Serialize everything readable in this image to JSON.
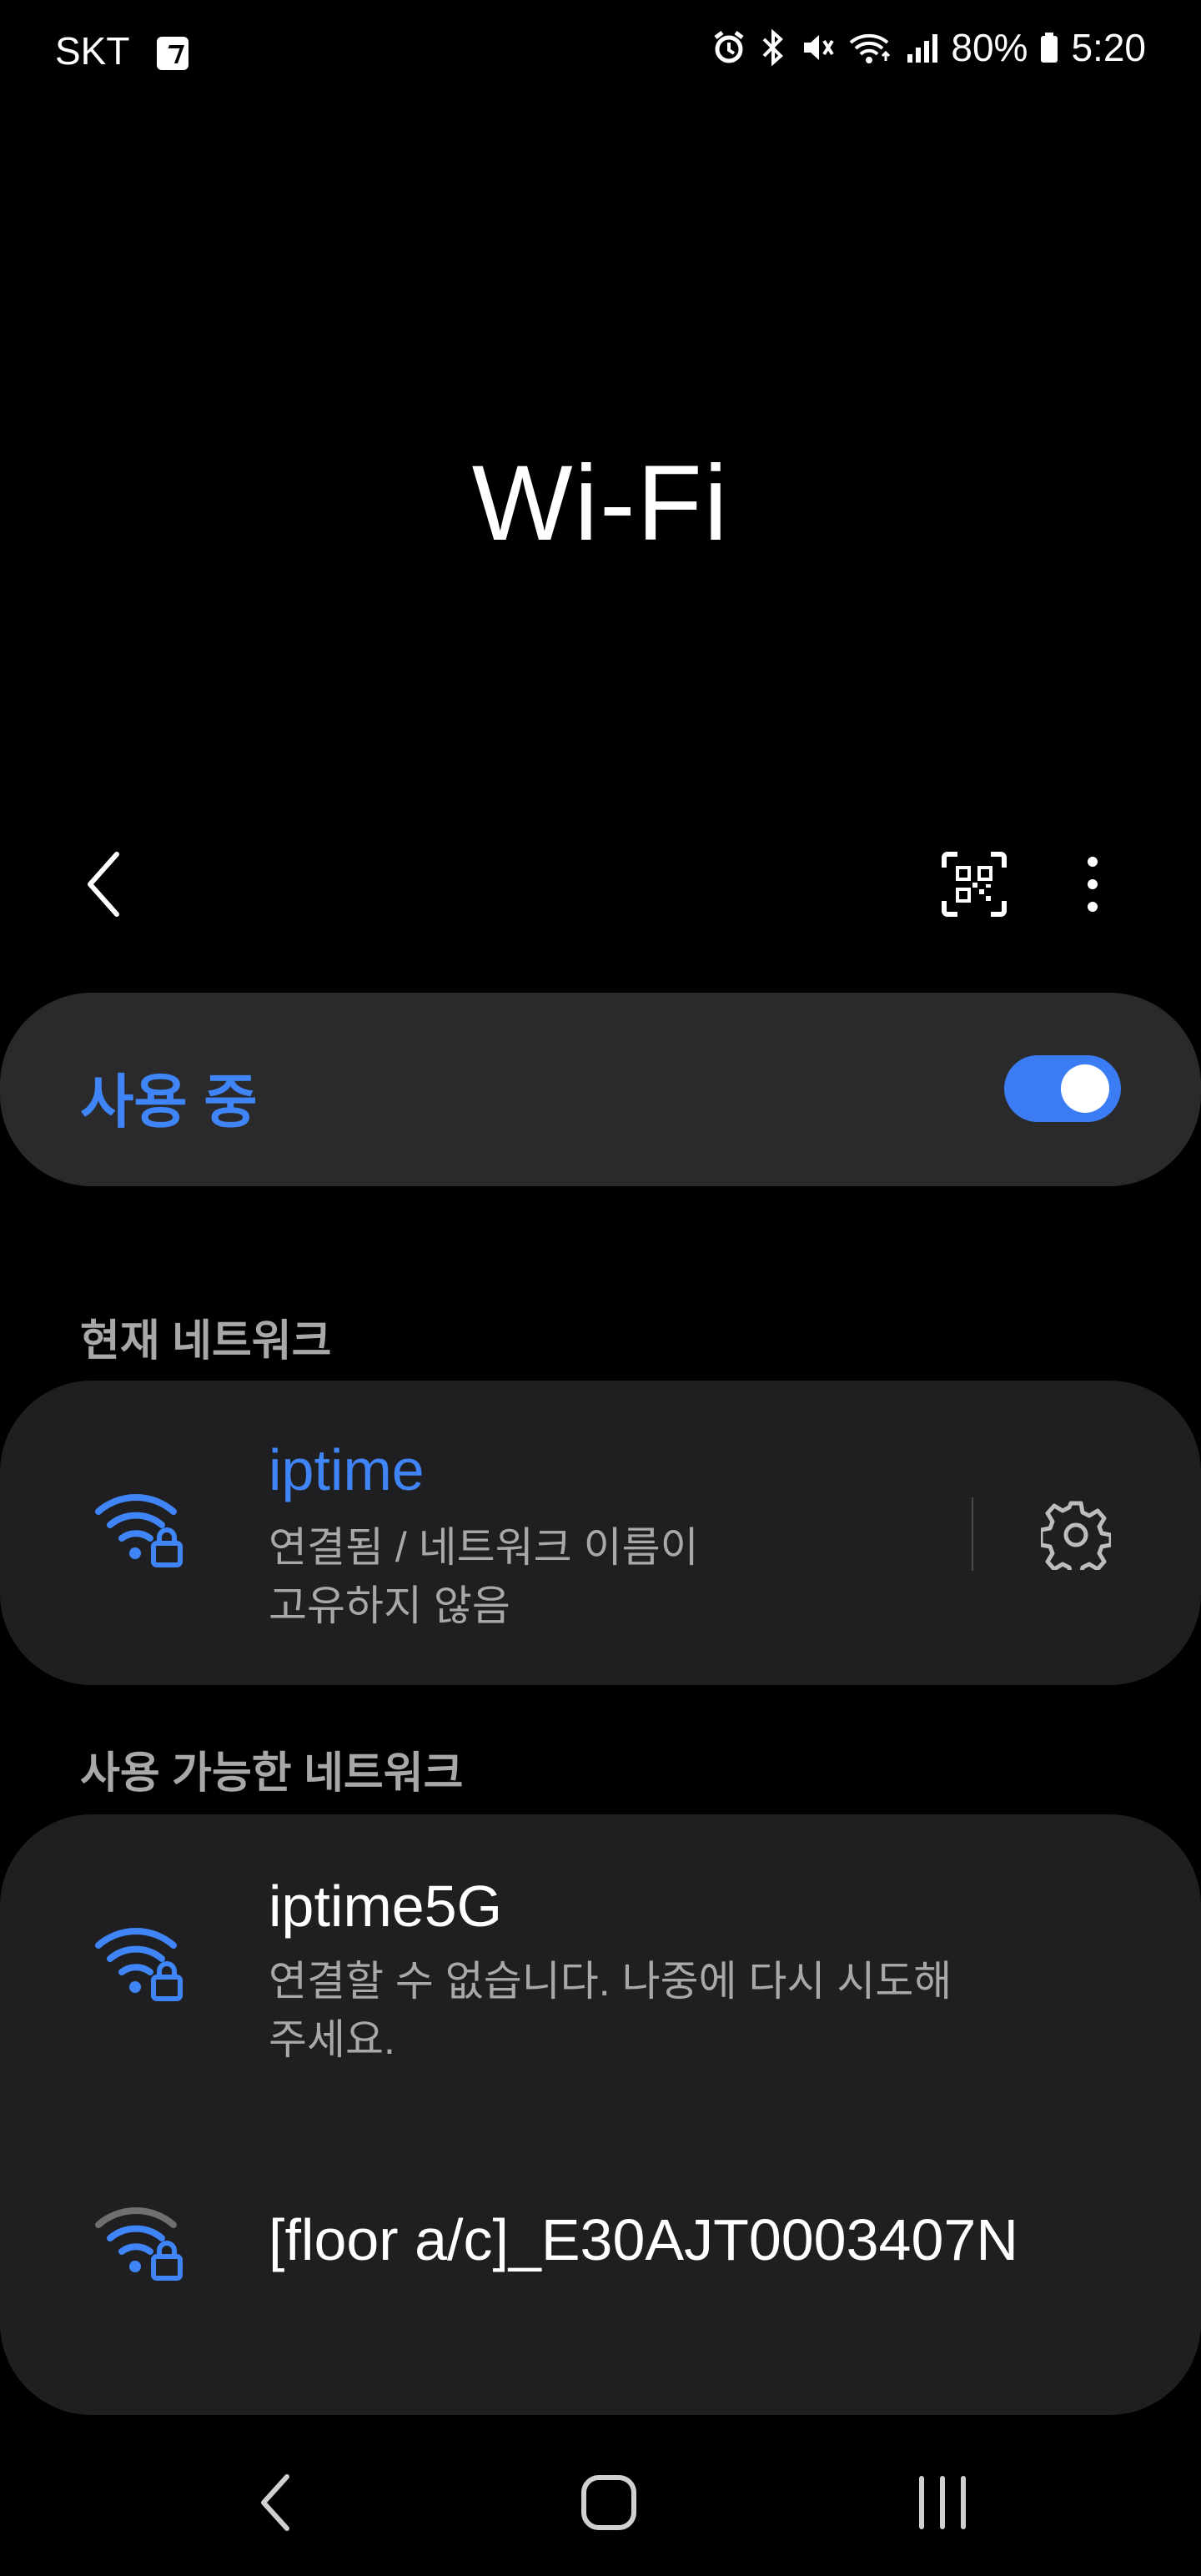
{
  "status_bar": {
    "carrier": "SKT",
    "battery": "80%",
    "time": "5:20"
  },
  "title": "Wi-Fi",
  "toggle": {
    "label": "사용 중",
    "on": true
  },
  "current_section": "현재 네트워크",
  "current_network": {
    "name": "iptime",
    "status_line1": "연결됨 / 네트워크 이름이",
    "status_line2": "고유하지 않음"
  },
  "available_section": "사용 가능한 네트워크",
  "available_networks": [
    {
      "name": "iptime5G",
      "status_line1": "연결할 수 없습니다. 나중에 다시 시도해",
      "status_line2": "주세요."
    },
    {
      "name": "[floor a/c]_E30AJT0003407N"
    }
  ],
  "colors": {
    "accent": "#3f85f7",
    "card": "#1f1f21",
    "background": "#000000"
  }
}
